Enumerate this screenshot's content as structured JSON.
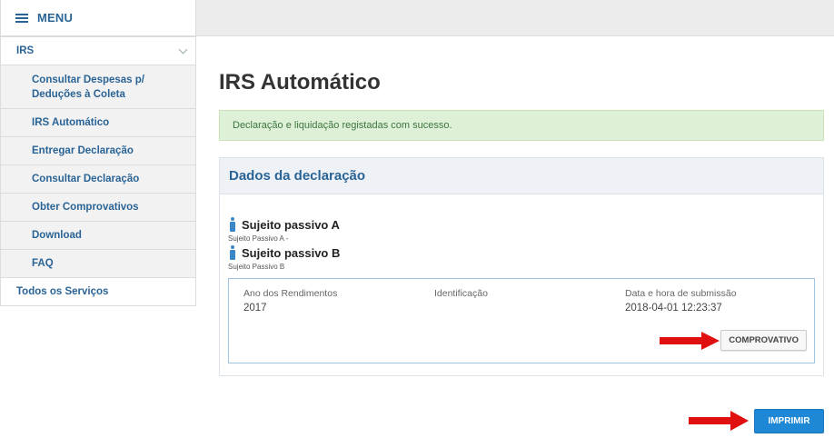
{
  "menu": {
    "label": "MENU",
    "icon": "hamburger-icon"
  },
  "sidebar": {
    "section": "IRS",
    "items": [
      {
        "label_line1": "Consultar Despesas p/",
        "label_line2": "Deduções à Coleta"
      },
      {
        "label": "IRS Automático"
      },
      {
        "label": "Entregar Declaração"
      },
      {
        "label": "Consultar Declaração"
      },
      {
        "label": "Obter Comprovativos"
      },
      {
        "label": "Download"
      },
      {
        "label": "FAQ"
      }
    ],
    "bottom": "Todos os Serviços"
  },
  "page": {
    "title": "IRS Automático",
    "alert": "Declaração e liquidação registadas com sucesso."
  },
  "panel": {
    "title": "Dados da declaração",
    "subjects": [
      {
        "name": "Sujeito passivo A",
        "sub": "Sujeito Passivo A -"
      },
      {
        "name": "Sujeito passivo B",
        "sub": "Sujeito Passivo B"
      }
    ],
    "columns": [
      {
        "header": "Ano dos Rendimentos",
        "value": "2017"
      },
      {
        "header": "Identificação",
        "value": ""
      },
      {
        "header": "Data e hora de submissão",
        "value": "2018-04-01 12:23:37"
      }
    ],
    "comprovativo_button": "COMPROVATIVO"
  },
  "print_button": "IMPRIMIR",
  "colors": {
    "accent": "#2a6496",
    "success_bg": "#dff0d8",
    "primary_button": "#1e88d6",
    "arrow": "#e01010"
  }
}
